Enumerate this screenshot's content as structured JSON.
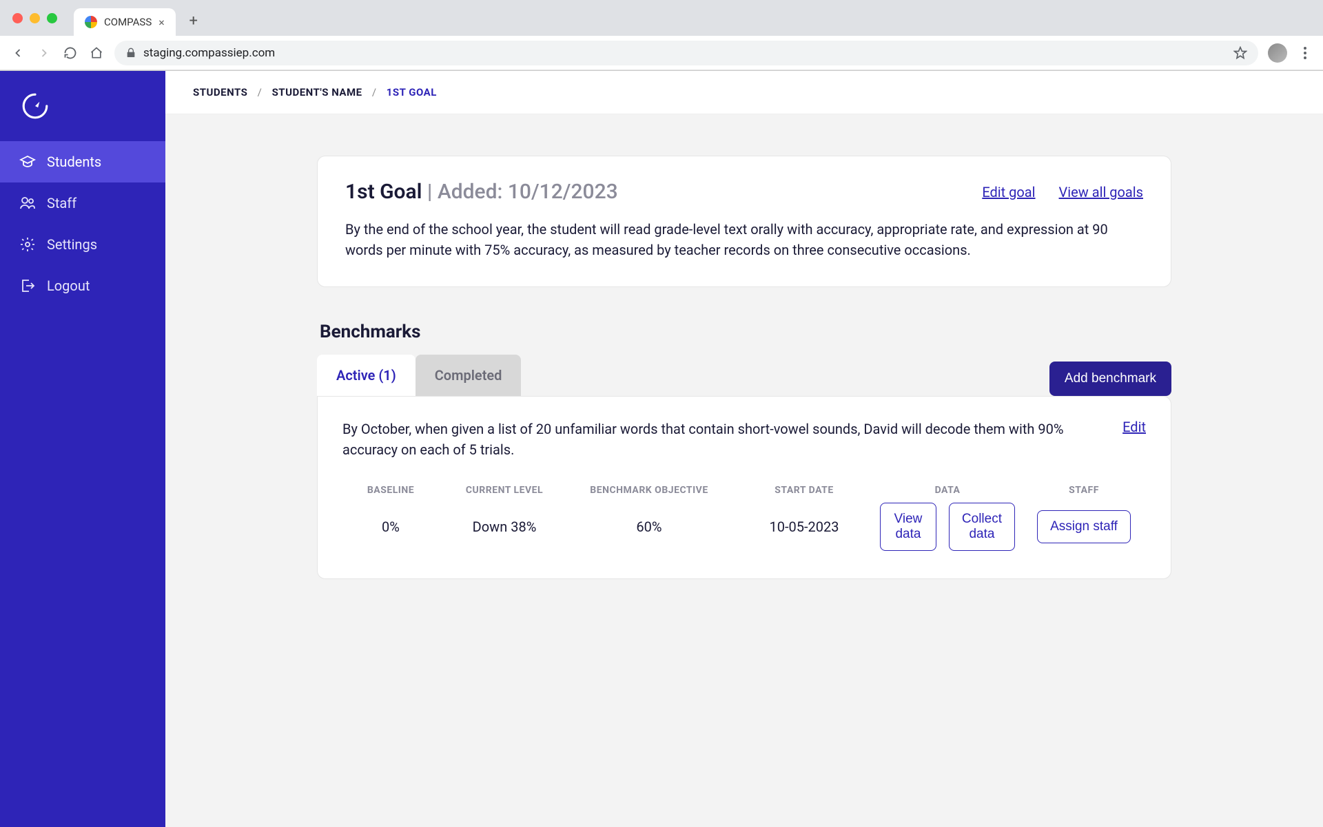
{
  "browser": {
    "tab_title": "COMPASS",
    "url": "staging.compassiep.com"
  },
  "sidebar": {
    "items": [
      {
        "label": "Students",
        "icon": "graduation-cap-icon",
        "active": true
      },
      {
        "label": "Staff",
        "icon": "users-icon",
        "active": false
      },
      {
        "label": "Settings",
        "icon": "gear-icon",
        "active": false
      },
      {
        "label": "Logout",
        "icon": "logout-icon",
        "active": false
      }
    ]
  },
  "breadcrumb": {
    "items": [
      "STUDENTS",
      "STUDENT'S NAME",
      "1ST GOAL"
    ]
  },
  "goal": {
    "title": "1st Goal",
    "added_label": "Added: 10/12/2023",
    "edit_link": "Edit goal",
    "view_all_link": "View all goals",
    "description": "By the end of the school year, the student will read grade-level text orally with accuracy, appropriate rate, and expression at 90 words per minute with 75% accuracy, as measured by teacher records on three consecutive occasions."
  },
  "benchmarks": {
    "section_title": "Benchmarks",
    "tabs": {
      "active_label": "Active (1)",
      "completed_label": "Completed"
    },
    "add_button": "Add benchmark",
    "item": {
      "description": "By October, when given a list of 20 unfamiliar words that contain short-vowel sounds, David will decode them with 90% accuracy on each of 5 trials.",
      "edit_link": "Edit",
      "columns": {
        "baseline_head": "BASELINE",
        "current_head": "CURRENT LEVEL",
        "objective_head": "BENCHMARK OBJECTIVE",
        "start_head": "START DATE",
        "data_head": "DATA",
        "staff_head": "STAFF",
        "baseline": "0%",
        "current": "Down 38%",
        "objective": "60%",
        "start": "10-05-2023",
        "view_data": "View data",
        "collect_data": "Collect data",
        "assign_staff": "Assign staff"
      }
    }
  }
}
